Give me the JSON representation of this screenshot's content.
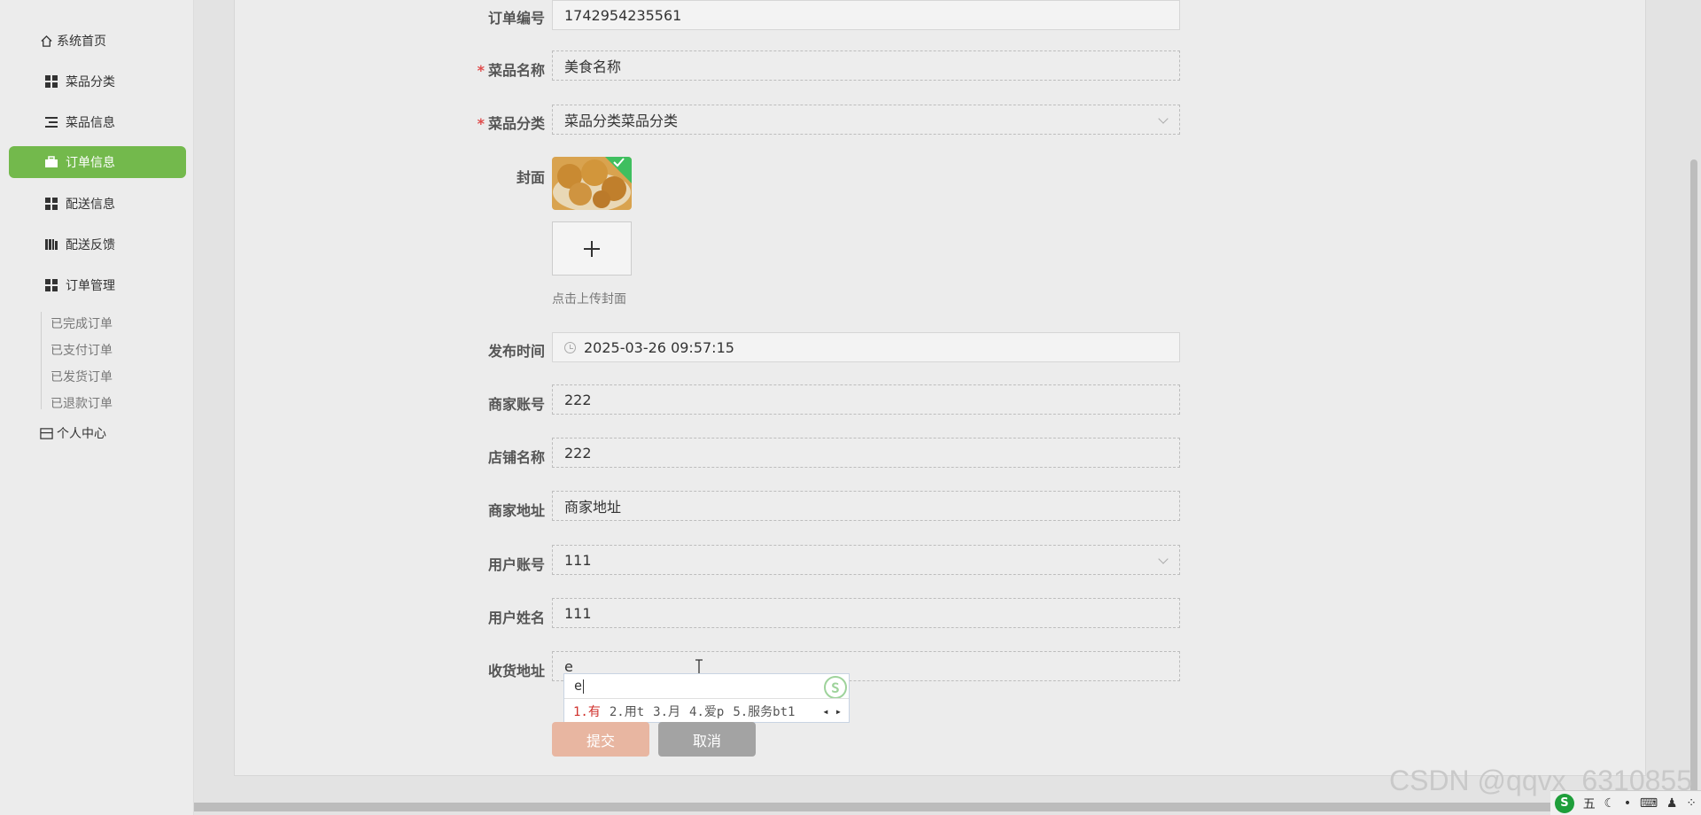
{
  "sidebar": {
    "items": [
      {
        "label": "系统首页",
        "icon": "home-icon"
      },
      {
        "label": "菜品分类",
        "icon": "grid-icon"
      },
      {
        "label": "菜品信息",
        "icon": "list-icon"
      },
      {
        "label": "订单信息",
        "icon": "briefcase-icon",
        "active": true
      },
      {
        "label": "配送信息",
        "icon": "grid-icon"
      },
      {
        "label": "配送反馈",
        "icon": "library-icon"
      },
      {
        "label": "订单管理",
        "icon": "grid-icon"
      }
    ],
    "order_sub": [
      "已完成订单",
      "已支付订单",
      "已发货订单",
      "已退款订单"
    ],
    "personal": {
      "label": "个人中心",
      "icon": "card-icon"
    }
  },
  "form": {
    "order_no": {
      "label": "订单编号",
      "value": "1742954235561"
    },
    "dish_name": {
      "label": "菜品名称",
      "value": "美食名称"
    },
    "dish_category": {
      "label": "菜品分类",
      "value": "菜品分类菜品分类"
    },
    "cover": {
      "label": "封面",
      "upload_tip": "点击上传封面"
    },
    "publish_time": {
      "label": "发布时间",
      "value": "2025-03-26 09:57:15"
    },
    "merchant_account": {
      "label": "商家账号",
      "value": "222"
    },
    "shop_name": {
      "label": "店铺名称",
      "value": "222"
    },
    "merchant_address": {
      "label": "商家地址",
      "value": "商家地址"
    },
    "user_account": {
      "label": "用户账号",
      "value": "111"
    },
    "user_name": {
      "label": "用户姓名",
      "value": "111"
    },
    "shipping_address": {
      "label": "收货地址",
      "value": "e"
    },
    "submit_label": "提交",
    "cancel_label": "取消",
    "required_mark": "*"
  },
  "ime": {
    "composition": "e",
    "candidates": [
      "1.有",
      "2.用t",
      "3.月",
      "4.爱p",
      "5.服务bt1"
    ],
    "logo_text": "S"
  },
  "watermark": "CSDN @qqvx_6310855",
  "tray": {
    "text": "五"
  },
  "colors": {
    "active_nav": "#73b94c",
    "submit": "#e8b6a1",
    "cancel": "#a3a3a3",
    "required": "#e04b4b"
  }
}
